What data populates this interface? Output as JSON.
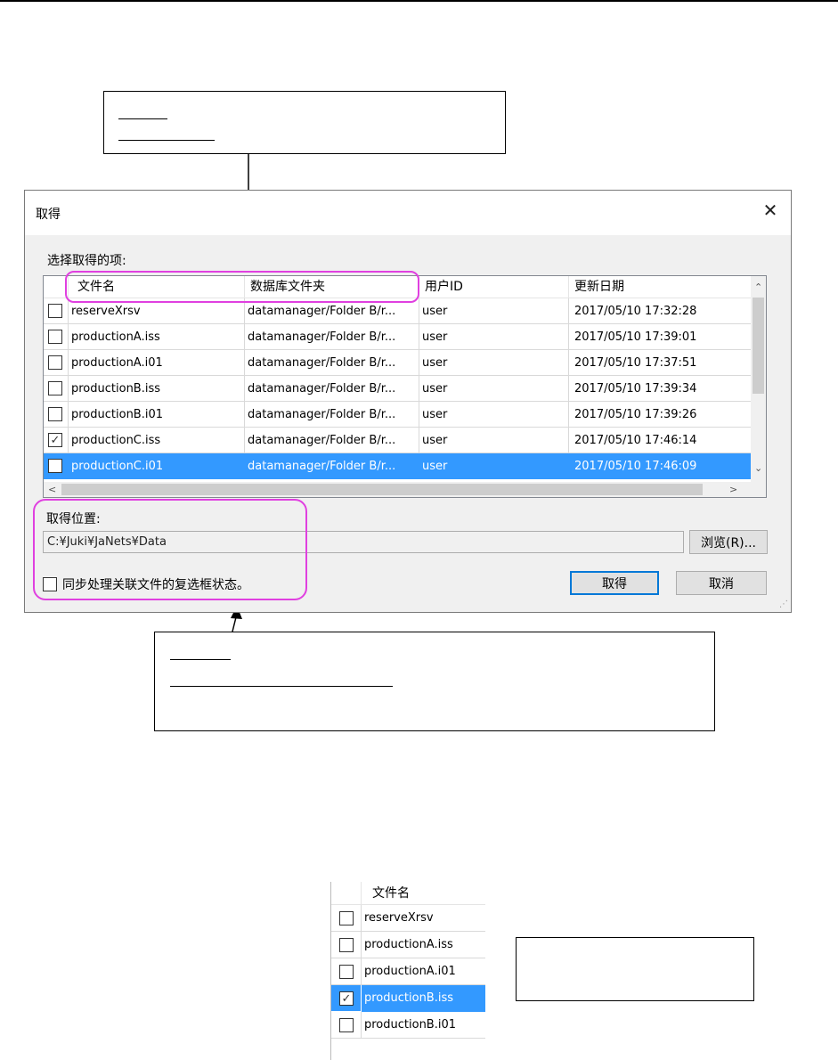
{
  "dialog": {
    "title": "取得",
    "close_glyph": "✕",
    "list_label": "选择取得的项:",
    "columns": [
      "文件名",
      "数据库文件夹",
      "用户ID",
      "更新日期"
    ],
    "rows": [
      {
        "checked": false,
        "selected": false,
        "name": "reserveXrsv",
        "folder": "datamanager/Folder B/r...",
        "user": "user",
        "date": "2017/05/10 17:32:28"
      },
      {
        "checked": false,
        "selected": false,
        "name": "productionA.iss",
        "folder": "datamanager/Folder B/r...",
        "user": "user",
        "date": "2017/05/10 17:39:01"
      },
      {
        "checked": false,
        "selected": false,
        "name": "productionA.i01",
        "folder": "datamanager/Folder B/r...",
        "user": "user",
        "date": "2017/05/10 17:37:51"
      },
      {
        "checked": false,
        "selected": false,
        "name": "productionB.iss",
        "folder": "datamanager/Folder B/r...",
        "user": "user",
        "date": "2017/05/10 17:39:34"
      },
      {
        "checked": false,
        "selected": false,
        "name": "productionB.i01",
        "folder": "datamanager/Folder B/r...",
        "user": "user",
        "date": "2017/05/10 17:39:26"
      },
      {
        "checked": true,
        "selected": false,
        "name": "productionC.iss",
        "folder": "datamanager/Folder B/r...",
        "user": "user",
        "date": "2017/05/10 17:46:14"
      },
      {
        "checked": false,
        "selected": true,
        "name": "productionC.i01",
        "folder": "datamanager/Folder B/r...",
        "user": "user",
        "date": "2017/05/10 17:46:09"
      }
    ],
    "scroll_glyphs": {
      "up": "⌃",
      "down": "⌄",
      "left": "<",
      "right": ">"
    },
    "location_label": "取得位置:",
    "location_value": "C:¥Juki¥JaNets¥Data",
    "browse_button": "浏览(R)...",
    "sync_checkbox_label": "同步处理关联文件的复选框状态。",
    "ok_button": "取得",
    "cancel_button": "取消",
    "resize_grip": "⋰"
  },
  "mini_list": {
    "column": "文件名",
    "rows": [
      {
        "checked": false,
        "selected": false,
        "name": "reserveXrsv"
      },
      {
        "checked": false,
        "selected": false,
        "name": "productionA.iss"
      },
      {
        "checked": false,
        "selected": false,
        "name": "productionA.i01"
      },
      {
        "checked": true,
        "selected": true,
        "name": "productionB.iss"
      },
      {
        "checked": false,
        "selected": false,
        "name": "productionB.i01"
      }
    ]
  },
  "colors": {
    "highlight": "#e040e0",
    "selection": "#3399ff",
    "default_button_border": "#0078d7"
  }
}
